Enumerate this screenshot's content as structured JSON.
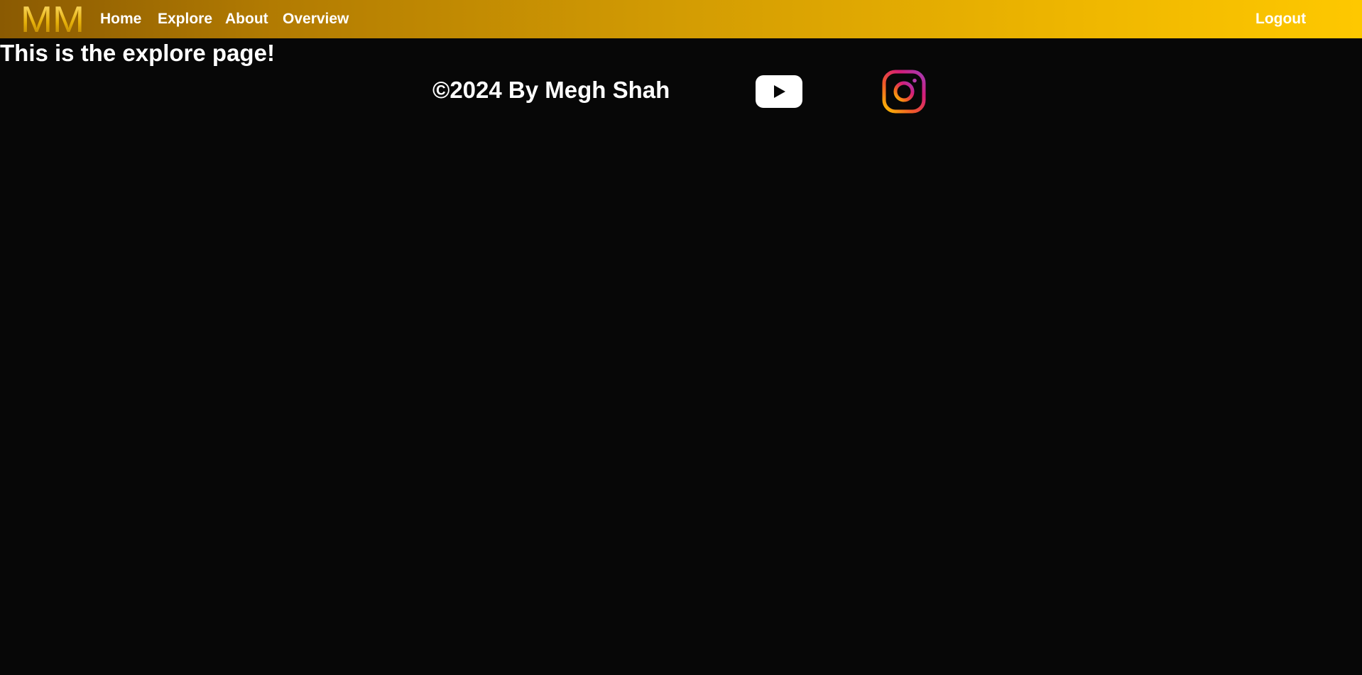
{
  "navbar": {
    "logo_text": "MM",
    "links": [
      {
        "label": "Home"
      },
      {
        "label": "Explore"
      },
      {
        "label": "About"
      },
      {
        "label": "Overview"
      }
    ],
    "logout_label": "Logout",
    "gradient_start": "#8a5a02",
    "gradient_end": "#fec800"
  },
  "main": {
    "heading": "This is the explore page!"
  },
  "footer": {
    "copyright": "©2024 By Megh Shah",
    "social": [
      {
        "icon": "youtube-icon"
      },
      {
        "icon": "instagram-icon"
      }
    ]
  },
  "colors": {
    "background": "#070707",
    "text": "#ffffff",
    "instagram_gradient": [
      "#fcc000",
      "#f05a28",
      "#d41d78",
      "#a23cb8"
    ]
  }
}
